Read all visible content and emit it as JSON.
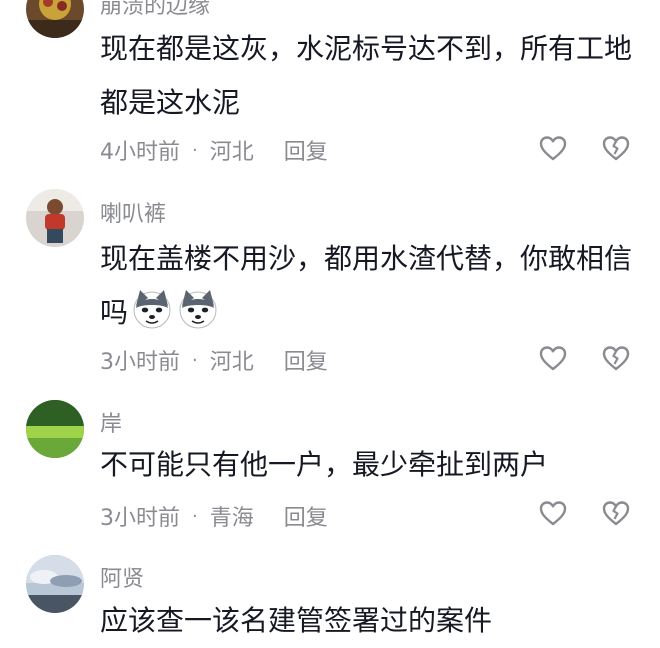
{
  "comments": [
    {
      "username": "崩溃的边缘",
      "text": "现在都是这灰，水泥标号达不到，所有工地都是这水泥",
      "time": "4小时前",
      "location": "河北",
      "reply_label": "回复"
    },
    {
      "username": "喇叭裤",
      "text": "现在盖楼不用沙，都用水渣代替，你敢相信吗",
      "time": "3小时前",
      "location": "河北",
      "reply_label": "回复",
      "emoji": [
        "doge-emoji",
        "doge-emoji"
      ]
    },
    {
      "username": "岸",
      "text": "不可能只有他一户，最少牵扯到两户",
      "time": "3小时前",
      "location": "青海",
      "reply_label": "回复"
    },
    {
      "username": "阿贤",
      "text": "应该查一该名建管签署过的案件"
    }
  ],
  "meta_separator": "·",
  "icons": {
    "like": "heart-outline-icon",
    "dislike": "broken-heart-outline-icon"
  },
  "colors": {
    "text": "#161823",
    "secondary": "#8a8b91",
    "icon": "#8a8b91"
  }
}
